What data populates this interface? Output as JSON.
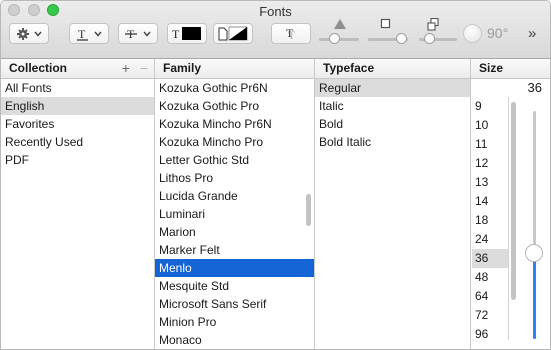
{
  "window": {
    "title": "Fonts"
  },
  "toolbar": {
    "rotation_label": "90°",
    "overflow_label": "»"
  },
  "collection": {
    "header": "Collection",
    "add_label": "+",
    "remove_label": "−",
    "items": [
      "All Fonts",
      "English",
      "Favorites",
      "Recently Used",
      "PDF"
    ],
    "selected": "English"
  },
  "family": {
    "header": "Family",
    "items": [
      "Kozuka Gothic Pr6N",
      "Kozuka Gothic Pro",
      "Kozuka Mincho Pr6N",
      "Kozuka Mincho Pro",
      "Letter Gothic Std",
      "Lithos Pro",
      "Lucida Grande",
      "Luminari",
      "Marion",
      "Marker Felt",
      "Menlo",
      "Mesquite Std",
      "Microsoft Sans Serif",
      "Minion Pro",
      "Monaco"
    ],
    "selected": "Menlo"
  },
  "typeface": {
    "header": "Typeface",
    "items": [
      "Regular",
      "Italic",
      "Bold",
      "Bold Italic"
    ],
    "selected": "Regular"
  },
  "size": {
    "header": "Size",
    "current": "36",
    "items": [
      "9",
      "10",
      "11",
      "12",
      "13",
      "14",
      "18",
      "24",
      "36",
      "48",
      "64",
      "72",
      "96"
    ],
    "selected": "36"
  },
  "colors": {
    "selection_blue": "#1564d6",
    "selection_gray": "#dcdcdc",
    "slider_fill": "#2f7ff5"
  }
}
